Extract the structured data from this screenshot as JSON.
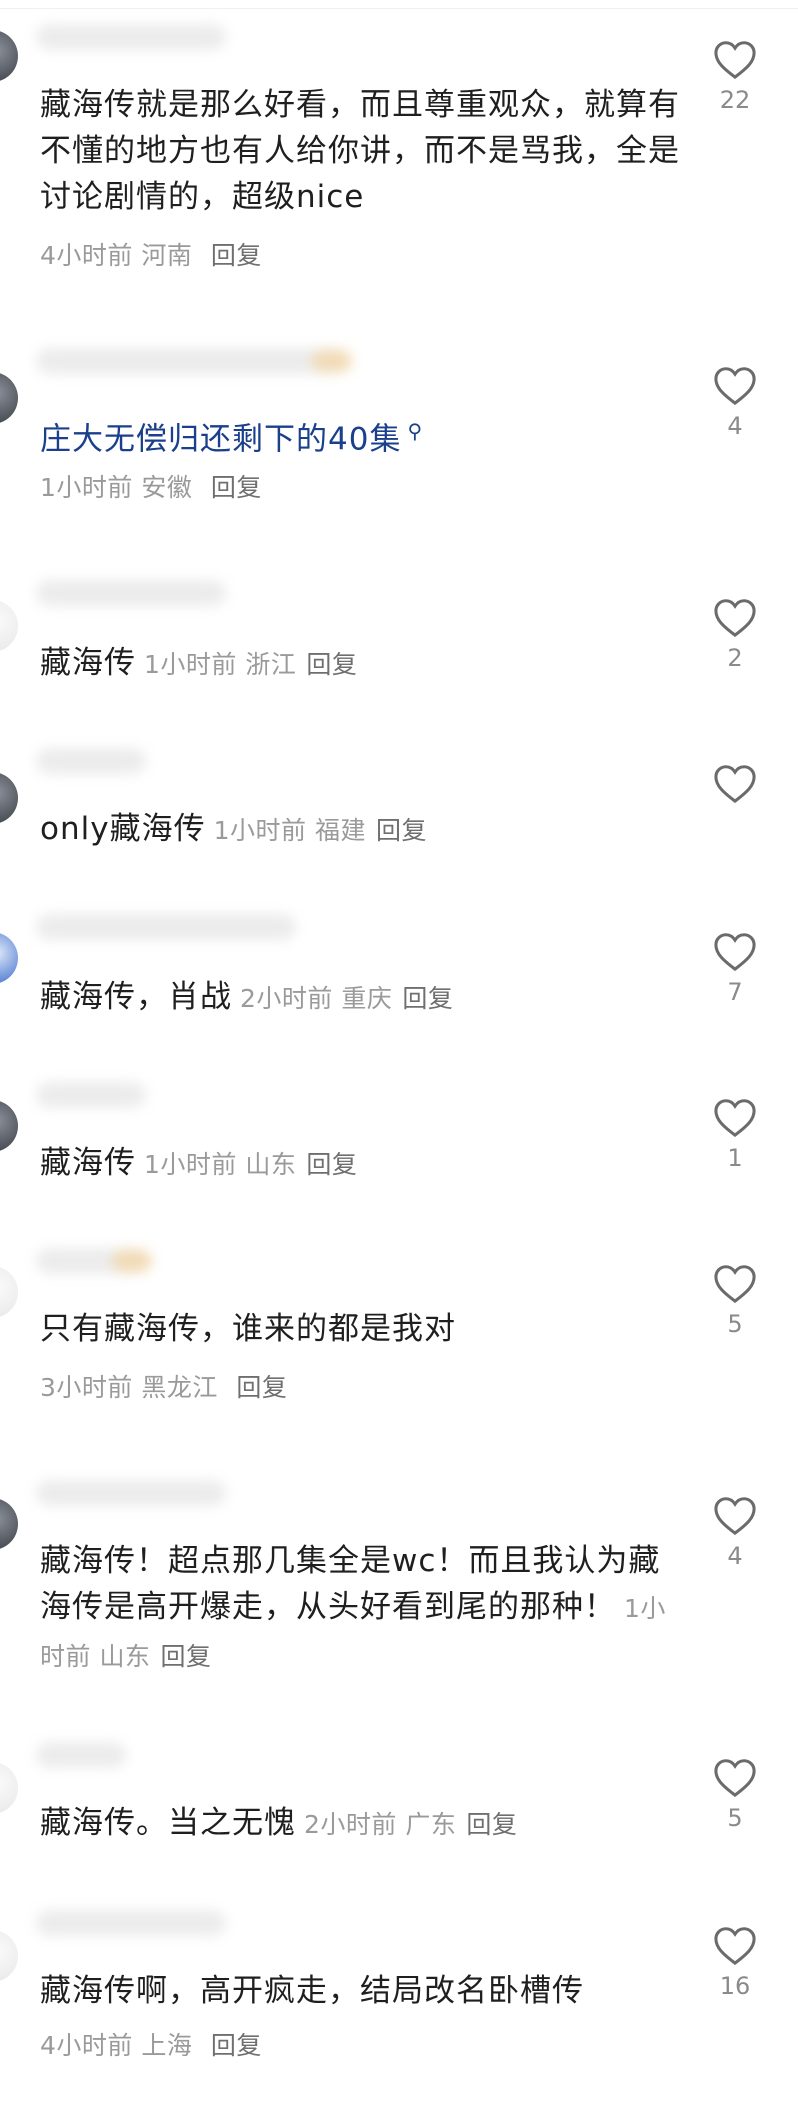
{
  "comments": [
    {
      "text": "藏海传就是那么好看，而且尊重观众，就算有不懂的地方也有人给你讲，而不是骂我，全是讨论剧情的，超级nice",
      "time": "4小时前",
      "location": "河南",
      "reply": "回复",
      "likes": "22"
    },
    {
      "text": "庄大无偿归还剩下的40集",
      "time": "1小时前",
      "location": "安徽",
      "reply": "回复",
      "likes": "4",
      "icon": "search-icon"
    },
    {
      "text": "藏海传",
      "time": "1小时前",
      "location": "浙江",
      "reply": "回复",
      "likes": "2"
    },
    {
      "text": "only藏海传",
      "time": "1小时前",
      "location": "福建",
      "reply": "回复",
      "likes": ""
    },
    {
      "text": "藏海传，肖战",
      "time": "2小时前",
      "location": "重庆",
      "reply": "回复",
      "likes": "7"
    },
    {
      "text": "藏海传",
      "time": "1小时前",
      "location": "山东",
      "reply": "回复",
      "likes": "1"
    },
    {
      "text": "只有藏海传，谁来的都是我对",
      "time": "3小时前",
      "location": "黑龙江",
      "reply": "回复",
      "likes": "5"
    },
    {
      "text": "藏海传！超点那几集全是wc！而且我认为藏海传是高开爆走，从头好看到尾的那种！",
      "time": "1小时前",
      "location": "山东",
      "reply": "回复",
      "likes": "4"
    },
    {
      "text": "藏海传。当之无愧",
      "time": "2小时前",
      "location": "广东",
      "reply": "回复",
      "likes": "5"
    },
    {
      "text": "藏海传啊，高开疯走，结局改名卧槽传",
      "time": "4小时前",
      "location": "上海",
      "reply": "回复",
      "likes": "16"
    }
  ],
  "colors": {
    "link": "#1a3f8c",
    "meta": "#9a9a9a",
    "text": "#1f1f1f"
  }
}
